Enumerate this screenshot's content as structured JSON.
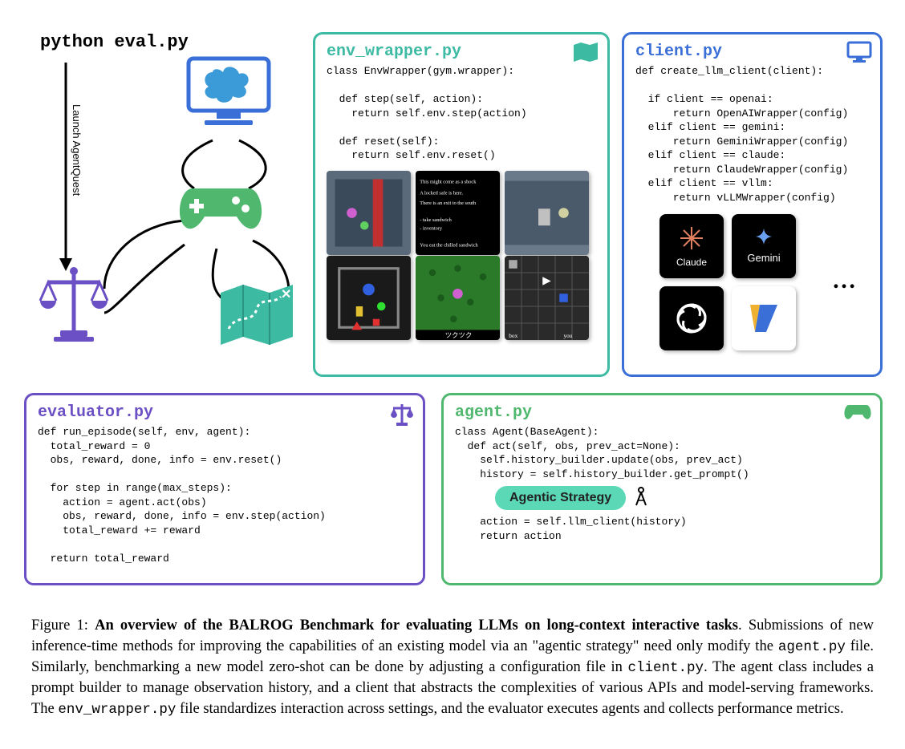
{
  "eval_cmd": "python eval.py",
  "launch_label": "Launch AgentQuest",
  "panels": {
    "env": {
      "title": "env_wrapper.py",
      "code": "class EnvWrapper(gym.wrapper):\n\n  def step(self, action):\n    return self.env.step(action)\n\n  def reset(self):\n    return self.env.reset()"
    },
    "client": {
      "title": "client.py",
      "code": "def create_llm_client(client):\n\n  if client == openai:\n      return OpenAIWrapper(config)\n  elif client == gemini:\n      return GeminiWrapper(config)\n  elif client == claude:\n      return ClaudeWrapper(config)\n  elif client == vllm:\n      return vLLMWrapper(config)",
      "logos": [
        "Claude",
        "Gemini",
        "OpenAI",
        "vLLM"
      ],
      "ellipsis": "…"
    },
    "evaluator": {
      "title": "evaluator.py",
      "code": "def run_episode(self, env, agent):\n  total_reward = 0\n  obs, reward, done, info = env.reset()\n\n  for step in range(max_steps):\n    action = agent.act(obs)\n    obs, reward, done, info = env.step(action)\n    total_reward += reward\n\n  return total_reward"
    },
    "agent": {
      "title": "agent.py",
      "code_top": "class Agent(BaseAgent):\n  def act(self, obs, prev_act=None):\n    self.history_builder.update(obs, prev_act)\n    history = self.history_builder.get_prompt()",
      "strategy_label": "Agentic Strategy",
      "code_bottom": "    action = self.llm_client(history)\n    return action"
    }
  },
  "caption": {
    "prefix": "Figure 1:",
    "bold": "An overview of the BALROG Benchmark for evaluating LLMs on long-context interactive tasks",
    "body1": ". Submissions of new inference-time methods for improving the capabilities of an existing model via an \"agentic strategy\" need only modify the ",
    "code1": "agent.py",
    "body2": " file. Similarly, benchmarking a new model zero-shot can be done by adjusting a configuration file in ",
    "code2": "client.py",
    "body3": ". The agent class includes a prompt builder to manage observation history, and a client that abstracts the complexities of various APIs and model-serving frameworks. The ",
    "code3": "env_wrapper.py",
    "body4": " file standardizes interaction across settings, and the evaluator executes agents and collects performance metrics."
  }
}
